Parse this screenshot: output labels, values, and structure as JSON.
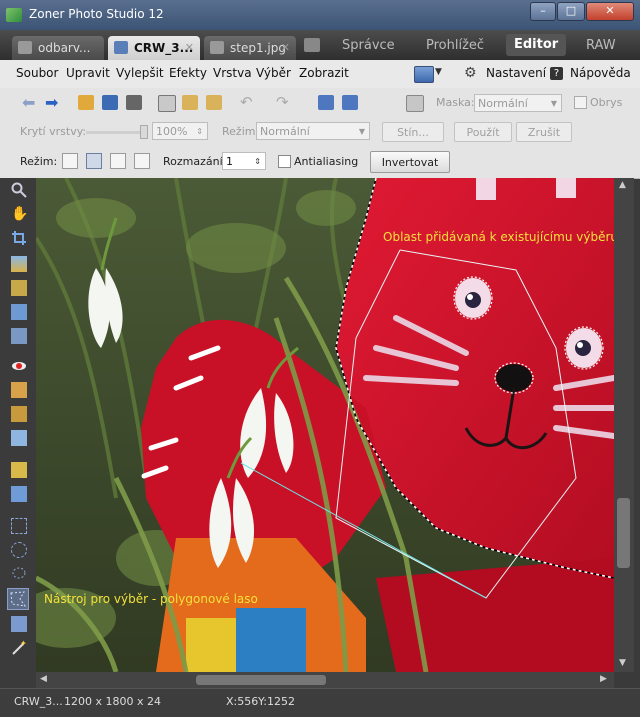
{
  "window": {
    "title": "Zoner Photo Studio 12"
  },
  "tabs": [
    {
      "label": "odbarv..."
    },
    {
      "label": "CRW_3..."
    },
    {
      "label": "step1.jpg"
    }
  ],
  "modes": [
    "Správce",
    "Prohlížeč",
    "Editor",
    "RAW"
  ],
  "menu": {
    "items": [
      "Soubor",
      "Upravit",
      "Vylepšit",
      "Efekty",
      "Vrstva",
      "Výběr",
      "Zobrazit"
    ],
    "settings": "Nastavení",
    "help": "Nápověda"
  },
  "toolbar1": {
    "mask_label": "Maska:",
    "mask_value": "Normální",
    "shadow_label": "Obrys"
  },
  "toolbar2": {
    "opacity_label": "Krytí vrstvy:",
    "opacity_value": "100%",
    "mode_label": "Režim:",
    "mode_value": "Normální",
    "shadow_btn": "Stín...",
    "apply_btn": "Použít",
    "cancel_btn": "Zrušit"
  },
  "toolbar3": {
    "mode_label": "Režim:",
    "blur_label": "Rozmazání:",
    "blur_value": "1",
    "antialias_label": "Antialiasing",
    "invert_btn": "Invertovat"
  },
  "annotations": {
    "area_note": "Oblast přidávaná k existujícímu výběru",
    "tool_note": "Nástroj pro výběr - polygonové laso"
  },
  "status": {
    "file": "CRW_3...",
    "dims": "1200 x 1800 x 24",
    "x": "X:556",
    "y": "Y:1252"
  },
  "colors": {
    "accent": "#f3e13a",
    "polygon": "#6fe3e6",
    "cat_red": "#d8132b"
  }
}
